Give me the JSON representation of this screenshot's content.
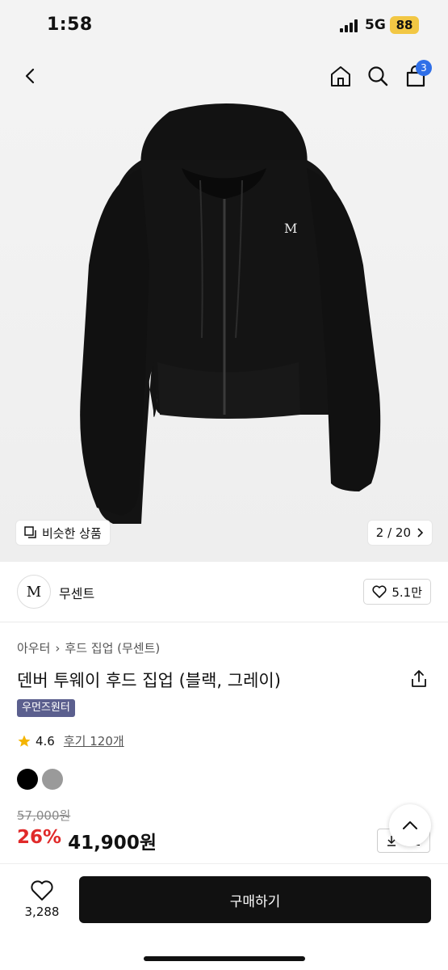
{
  "status": {
    "time": "1:58",
    "network": "5G",
    "battery": "88"
  },
  "nav": {
    "cart_count": "3"
  },
  "gallery": {
    "similar_label": "비슷한 상품",
    "page_indicator": "2 / 20"
  },
  "brand": {
    "logo_text": "M",
    "name": "무센트",
    "likes": "5.1만"
  },
  "breadcrumb": {
    "category": "아우터",
    "subcategory": "후드 집업 (무센트)"
  },
  "product": {
    "title": "덴버 투웨이 후드 집업 (블랙, 그레이)",
    "tag": "우먼즈원터",
    "rating": "4.6",
    "reviews": "후기 120개",
    "colors": [
      "#000000",
      "#9a9a9a"
    ],
    "original_price": "57,000원",
    "discount": "26%",
    "price": "41,900원",
    "coupon_label": "쿠폰"
  },
  "bottom": {
    "wish_count": "3,288",
    "buy_label": "구매하기"
  }
}
